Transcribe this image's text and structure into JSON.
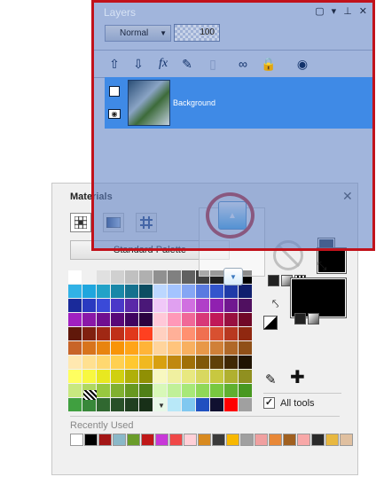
{
  "layers": {
    "title": "Layers",
    "blend_mode": "Normal",
    "opacity": "100",
    "layer_name": "Background"
  },
  "materials": {
    "title": "Materials",
    "palette_name": "Standard Palette",
    "recently_used_label": "Recently Used",
    "all_tools_label": "All tools",
    "swatches": [
      "#ffffff",
      "#f0f0f0",
      "#e0e0e0",
      "#d0d0d0",
      "#c0c0c0",
      "#b0b0b0",
      "#909090",
      "#808080",
      "#606060",
      "#404040",
      "#202020",
      "#101010",
      "#000000",
      "#31b2e6",
      "#1fa6de",
      "#22a2c8",
      "#1987a8",
      "#15718e",
      "#0c4d62",
      "#bcd7ff",
      "#a4c4ff",
      "#85a6f4",
      "#5a7ae0",
      "#3355cc",
      "#1f3ba8",
      "#101f6e",
      "#1a2a9a",
      "#2a3ac0",
      "#3a4ad8",
      "#4a38c8",
      "#5a28a8",
      "#4a1878",
      "#f0c8f8",
      "#e0a0f0",
      "#d070e0",
      "#b040c8",
      "#9020b0",
      "#701890",
      "#501060",
      "#a020c0",
      "#8a18a8",
      "#700f90",
      "#580878",
      "#400460",
      "#2a0240",
      "#ffc8d8",
      "#ff98b8",
      "#f06898",
      "#d83878",
      "#c01858",
      "#981040",
      "#700828",
      "#60180a",
      "#802010",
      "#a02814",
      "#c03018",
      "#e0381c",
      "#ff4020",
      "#ffd0c0",
      "#ffb098",
      "#ff9070",
      "#f07050",
      "#d85030",
      "#b83820",
      "#902810",
      "#c86428",
      "#d8741c",
      "#e88410",
      "#f89408",
      "#ffa418",
      "#ffb438",
      "#ffd49c",
      "#ffc47c",
      "#f8b060",
      "#e89848",
      "#d08038",
      "#b06828",
      "#905018",
      "#ffe8b0",
      "#ffe090",
      "#ffd870",
      "#ffd050",
      "#ffc830",
      "#f0b820",
      "#d8a010",
      "#c08810",
      "#a07008",
      "#805808",
      "#604008",
      "#402804",
      "#201402",
      "#ffff60",
      "#f8f840",
      "#e8e820",
      "#d0d010",
      "#b0b008",
      "#909004",
      "#f8f8c0",
      "#f0f0a0",
      "#e8e880",
      "#d8d860",
      "#c8c840",
      "#b0b030",
      "#909020",
      "#c8e880",
      "#b0d860",
      "#98c840",
      "#80b030",
      "#689820",
      "#508018",
      "#d8f8b8",
      "#c0f098",
      "#a8e878",
      "#90d858",
      "#78c840",
      "#60b030",
      "#489820",
      "#40a040",
      "#38883a",
      "#306830",
      "#285028",
      "#204020",
      "#183018",
      "#e8f8e8",
      "#b8e8f8",
      "#80c8f0",
      "#2050c0",
      "#101030",
      "#ff0000",
      "#a0a0a0"
    ],
    "recent": [
      "#ffffff",
      "#000000",
      "#a31616",
      "#8ab8c8",
      "#6a9c2a",
      "#c01818",
      "#c838d8",
      "#f04848",
      "#ffd0d8",
      "#d88a20",
      "#3a3a3a",
      "#f8b800",
      "#a0a0a0",
      "#f0a0a0",
      "#e88838",
      "#a06020",
      "#f8a8a8",
      "#2a2a2a",
      "#e8b840",
      "#e0c0a0"
    ]
  }
}
